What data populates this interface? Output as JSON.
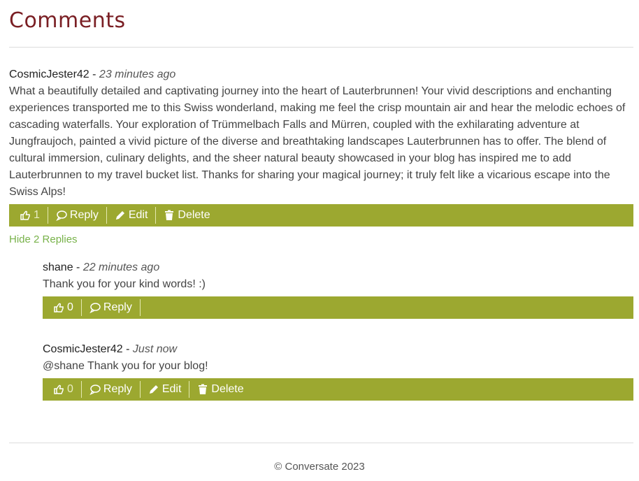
{
  "heading": "Comments",
  "colors": {
    "accent": "#9ca830",
    "heading": "#7a1f24",
    "link": "#78b24a"
  },
  "comments": [
    {
      "author": "CosmicJester42",
      "separator": " - ",
      "time": "23 minutes ago",
      "text": "What a beautifully detailed and captivating journey into the heart of Lauterbrunnen! Your vivid descriptions and enchanting experiences transported me to this Swiss wonderland, making me feel the crisp mountain air and hear the melodic echoes of cascading waterfalls. Your exploration of Trümmelbach Falls and Mürren, coupled with the exhilarating adventure at Jungfraujoch, painted a vivid picture of the diverse and breathtaking landscapes Lauterbrunnen has to offer. The blend of cultural immersion, culinary delights, and the sheer natural beauty showcased in your blog has inspired me to add Lauterbrunnen to my travel bucket list. Thanks for sharing your magical journey; it truly felt like a vicarious escape into the Swiss Alps!",
      "likes": "1",
      "actions": {
        "reply": "Reply",
        "edit": "Edit",
        "delete": "Delete"
      },
      "toggle_replies": "Hide 2 Replies"
    }
  ],
  "replies": [
    {
      "author": "shane",
      "separator": " - ",
      "time": "22 minutes ago",
      "text": "Thank you for your kind words! :)",
      "likes": "0",
      "actions": {
        "reply": "Reply"
      }
    },
    {
      "author": "CosmicJester42",
      "separator": " - ",
      "time": "Just now",
      "text": "@shane Thank you for your blog!",
      "likes": "0",
      "actions": {
        "reply": "Reply",
        "edit": "Edit",
        "delete": "Delete"
      }
    }
  ],
  "icons": [
    "thumbs-up-icon",
    "speech-bubble-icon",
    "pencil-icon",
    "trash-icon"
  ],
  "footer": "© Conversate 2023"
}
